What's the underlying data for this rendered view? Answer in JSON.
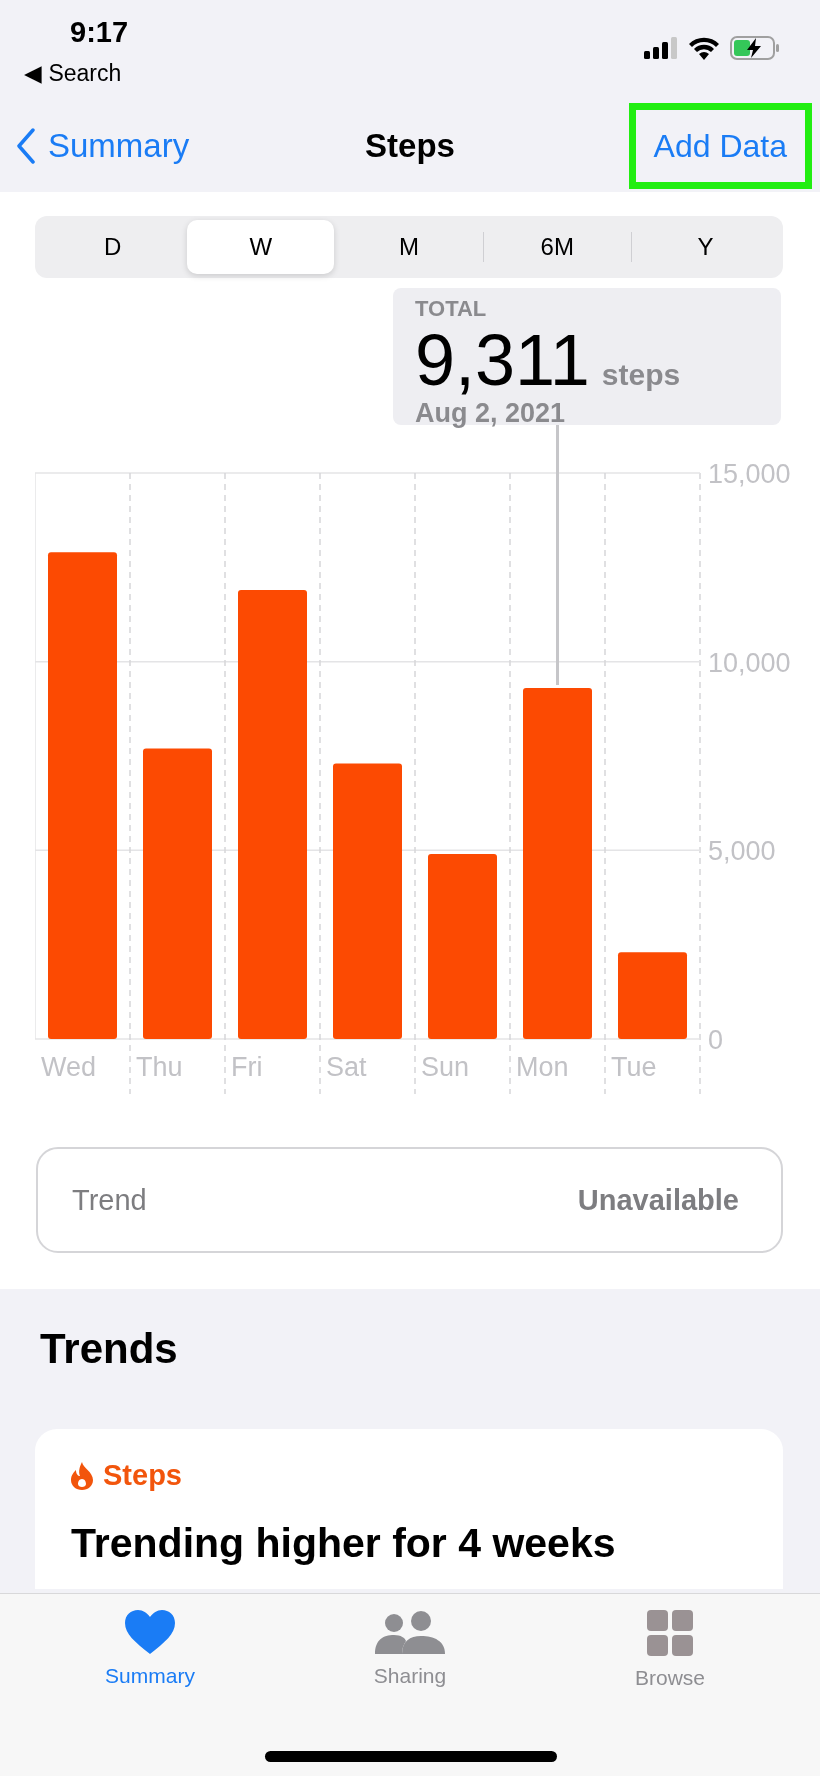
{
  "status_bar": {
    "time": "9:17",
    "back_app": "◀ Search"
  },
  "nav_bar": {
    "back": "Summary",
    "title": "Steps",
    "action": {
      "label": "Add Data",
      "highlighted": true
    }
  },
  "segments": [
    {
      "label": "D",
      "selected": false
    },
    {
      "label": "W",
      "selected": true
    },
    {
      "label": "M",
      "selected": false
    },
    {
      "label": "6M",
      "selected": false
    },
    {
      "label": "Y",
      "selected": false
    }
  ],
  "tooltip": {
    "heading": "TOTAL",
    "value": "9,311",
    "unit": "steps",
    "date": "Aug 2, 2021"
  },
  "chart": {
    "chart_data": {
      "type": "bar",
      "categories": [
        "Wed",
        "Thu",
        "Fri",
        "Sat",
        "Sun",
        "Mon",
        "Tue"
      ],
      "values": [
        12900,
        7700,
        11900,
        7300,
        4900,
        9300,
        2300
      ],
      "ylim": [
        0,
        15000
      ],
      "yticks": [
        {
          "value": 0,
          "label": "0"
        },
        {
          "value": 5000,
          "label": "5,000"
        },
        {
          "value": 10000,
          "label": "10,000"
        },
        {
          "value": 15000,
          "label": "15,000"
        }
      ],
      "annotations": [
        {
          "x": "Mon"
        }
      ]
    }
  },
  "trend": {
    "label": "Trend",
    "value": "Unavailable"
  },
  "trends_section": {
    "title": "Trends",
    "card": {
      "category": "Steps",
      "headline": "Trending higher for 4 weeks"
    }
  },
  "tab_bar": [
    {
      "label": "Summary",
      "kind": "heart",
      "selected": true
    },
    {
      "label": "Sharing",
      "kind": "people",
      "selected": false
    },
    {
      "label": "Browse",
      "kind": "grid",
      "selected": false
    }
  ]
}
